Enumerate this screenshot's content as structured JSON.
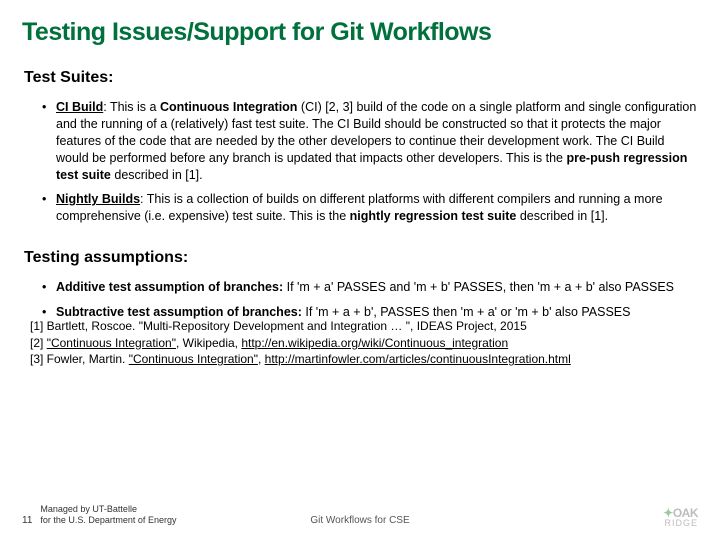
{
  "title": "Testing Issues/Support for Git Workflows",
  "sections": {
    "suites": {
      "heading": "Test Suites:",
      "ci_label": "CI Build",
      "ci_pre": ":  This is a ",
      "ci_ci_bold": "Continuous Integration",
      "ci_mid": " (CI) [2, 3] build of the code on a single platform and single configuration and the running of a (relatively) fast test suite.  The CI Build should be constructed so that it protects the major features of the code that are needed by the other developers to continue their development work.   The CI Build would be performed before any branch is updated that impacts other developers.  This is the ",
      "ci_tail_bold": "pre-push regression test suite",
      "ci_tail": " described in [1].",
      "nb_label": "Nightly Builds",
      "nb_pre": ":  This is a collection of builds on different platforms with different compilers and running a more comprehensive (i.e. expensive) test suite. This is the ",
      "nb_bold": "nightly regression test suite",
      "nb_tail": " described in [1]."
    },
    "assumptions": {
      "heading": "Testing assumptions:",
      "add_label": "Additive test assumption of branches:",
      "add_text": "  If 'm + a' PASSES and 'm + b' PASSES, then 'm + a + b' also PASSES",
      "sub_label": "Subtractive test assumption of branches:",
      "sub_text": "  If 'm + a + b', PASSES then 'm + a' or 'm + b' also PASSES"
    }
  },
  "refs": {
    "r1a": "[1] Bartlett, Roscoe. \"Multi-Repository Development and Integration … \", IDEAS Project, 2015",
    "r2a": "[2] ",
    "r2b": "\"Continuous Integration\"",
    "r2c": ", Wikipedia, ",
    "r2d": "http://en.wikipedia.org/wiki/Continuous_integration",
    "r3a": "[3] Fowler, Martin. ",
    "r3b": "\"Continuous Integration\"",
    "r3c": ", ",
    "r3d": "http://martinfowler.com/articles/continuousIntegration.html"
  },
  "footer": {
    "page": "11",
    "managed1": "Managed by UT-Battelle",
    "managed2": "for the U.S. Department of Energy",
    "center": "Git Workflows for CSE",
    "logo_top": "OAK",
    "logo_leaf": "✦",
    "logo_bot": "RIDGE"
  }
}
